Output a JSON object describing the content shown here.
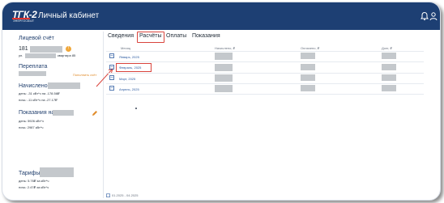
{
  "header": {
    "logo_text": "ТГК-2",
    "logo_subtext": "ЭНЕРГОСБЫТ",
    "title": "Личный кабинет",
    "icons": [
      "bell-icon",
      "user-icon"
    ]
  },
  "sidebar": {
    "account": {
      "title": "Лицевой счёт",
      "number": "181",
      "address_prefix": "ул.",
      "address_suffix": "квартира 85"
    },
    "overpayment": {
      "title": "Переплата"
    },
    "charged": {
      "title": "Начислено",
      "day": "день: -31 кВт*ч на -178.56₽",
      "night": "ночь: -11 кВт*ч на -27.17₽",
      "topup": "Пополнить счёт"
    },
    "readings": {
      "title": "Показания на",
      "day": "день: 5926 кВт*ч",
      "night": "ночь: 2987 кВт*ч"
    },
    "tariffs": {
      "title": "Тарифы",
      "day": "день: 5.76₽ за кВт*ч",
      "night": "ночь: 2.47₽ за кВт*ч"
    }
  },
  "tabs": [
    {
      "label": "Сведения",
      "active": false
    },
    {
      "label": "Расчёты",
      "active": true
    },
    {
      "label": "Оплаты",
      "active": false
    },
    {
      "label": "Показания",
      "active": false
    }
  ],
  "table": {
    "headers": [
      "Месяц",
      "Начислено, ₽",
      "Оплачено, ₽",
      "Долг, ₽"
    ],
    "rows": [
      {
        "month": "Январь, 2025"
      },
      {
        "month": "Февраль, 2025",
        "highlighted": true
      },
      {
        "month": "Март, 2025"
      },
      {
        "month": "Апрель, 2025"
      }
    ]
  },
  "footer": {
    "period": "01.2025 - 04.2025"
  },
  "colors": {
    "topbar": "#1d3f73",
    "accent": "#2b5aa0",
    "highlight": "#d9443c",
    "warning": "#f0a73a"
  }
}
